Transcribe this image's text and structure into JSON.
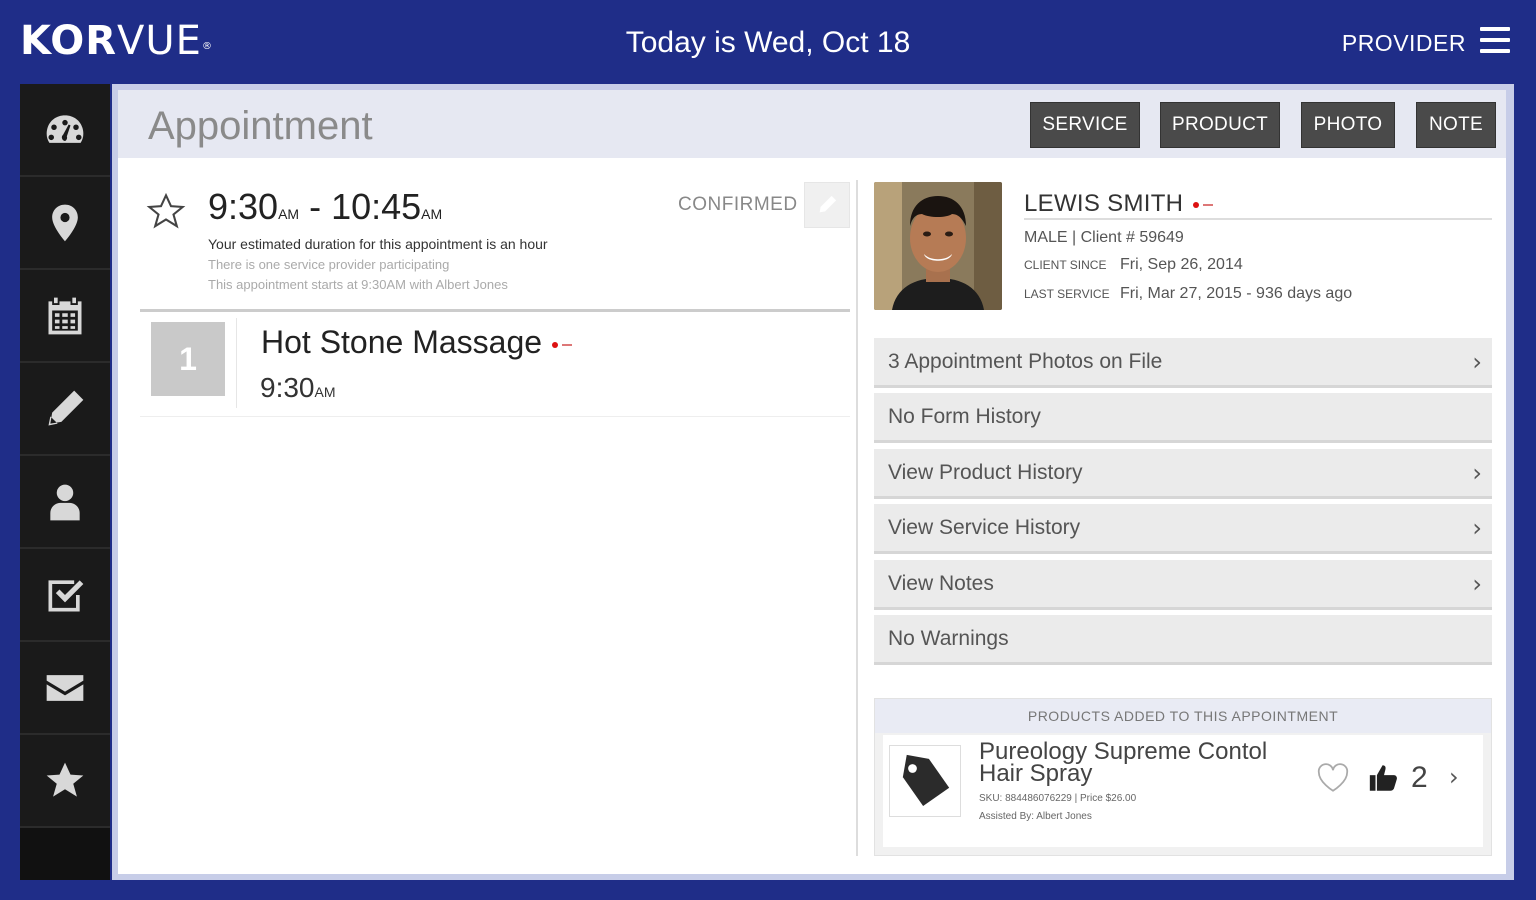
{
  "header": {
    "logo_bold": "KOR",
    "logo_light": "VUE",
    "logo_mark": "®",
    "today": "Today is Wed, Oct 18",
    "role": "PROVIDER"
  },
  "sidebar": {
    "items": [
      {
        "icon": "dashboard-icon"
      },
      {
        "icon": "map-pin-icon"
      },
      {
        "icon": "calendar-icon"
      },
      {
        "icon": "pencil-icon"
      },
      {
        "icon": "person-icon"
      },
      {
        "icon": "checkbox-icon"
      },
      {
        "icon": "envelope-icon"
      },
      {
        "icon": "star-icon"
      }
    ]
  },
  "page": {
    "title": "Appointment",
    "buttons": {
      "service": "SERVICE",
      "product": "PRODUCT",
      "photo": "PHOTO",
      "note": "NOTE"
    }
  },
  "appointment": {
    "start": "9:30",
    "start_ampm": "AM",
    "separator": " - ",
    "end": "10:45",
    "end_ampm": "AM",
    "status": "CONFIRMED",
    "duration_text": "Your estimated duration for this appointment is an hour",
    "providers_text": "There is one service provider participating",
    "starts_text": "This appointment starts at 9:30AM with Albert Jones"
  },
  "service": {
    "number": "1",
    "name": "Hot Stone Massage",
    "time": "9:30",
    "time_ampm": "AM"
  },
  "client": {
    "name": "LEWIS SMITH",
    "gender_id": "MALE | Client # 59649",
    "since_label": "CLIENT SINCE",
    "since_value": "Fri, Sep 26, 2014",
    "last_label": "LAST SERVICE",
    "last_value": "Fri, Mar 27, 2015 - 936 days ago"
  },
  "history": [
    {
      "label": "3 Appointment Photos on File",
      "chevron": true
    },
    {
      "label": "No Form History",
      "chevron": false
    },
    {
      "label": "View Product History",
      "chevron": true
    },
    {
      "label": "View Service History",
      "chevron": true
    },
    {
      "label": "View Notes",
      "chevron": true
    },
    {
      "label": "No Warnings",
      "chevron": false
    }
  ],
  "products": {
    "heading": "PRODUCTS ADDED TO THIS APPOINTMENT",
    "item": {
      "name": "Pureology Supreme Contol Hair Spray",
      "sku": "SKU: 884486076229 | Price $26.00",
      "added_by": "Assisted By: Albert Jones",
      "quantity": "2"
    }
  },
  "colors": {
    "brand_navy": "#1f2d88",
    "sidebar": "#111111",
    "header_button": "#4a4a4a",
    "accent_red": "#dd1111"
  }
}
